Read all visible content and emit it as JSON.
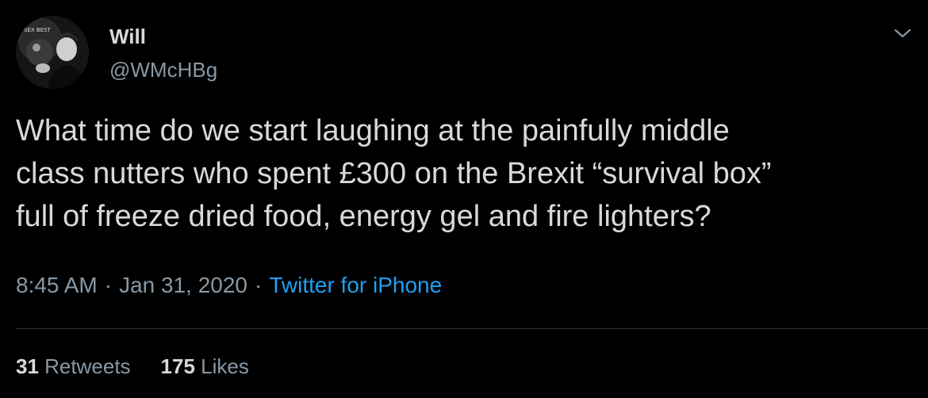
{
  "tweet": {
    "author": {
      "name": "Will",
      "handle": "@WMcHBg",
      "avatar_icon": "profile-photo"
    },
    "menu_icon": "chevron-down-icon",
    "text_lines": [
      "What time do we start laughing at the painfully middle",
      "class nutters who spent £300 on the Brexit “survival box”",
      "full of freeze dried food, energy gel and fire lighters?"
    ],
    "time": "8:45 AM",
    "separator": "·",
    "date": "Jan 31, 2020",
    "source": "Twitter for iPhone",
    "stats": {
      "retweets_count": "31",
      "retweets_label": "Retweets",
      "likes_count": "175",
      "likes_label": "Likes"
    }
  },
  "colors": {
    "background": "#000000",
    "text_primary": "#D9D9D9",
    "text_secondary": "#8899A6",
    "link": "#1DA1F2",
    "divider": "#2F3336"
  }
}
